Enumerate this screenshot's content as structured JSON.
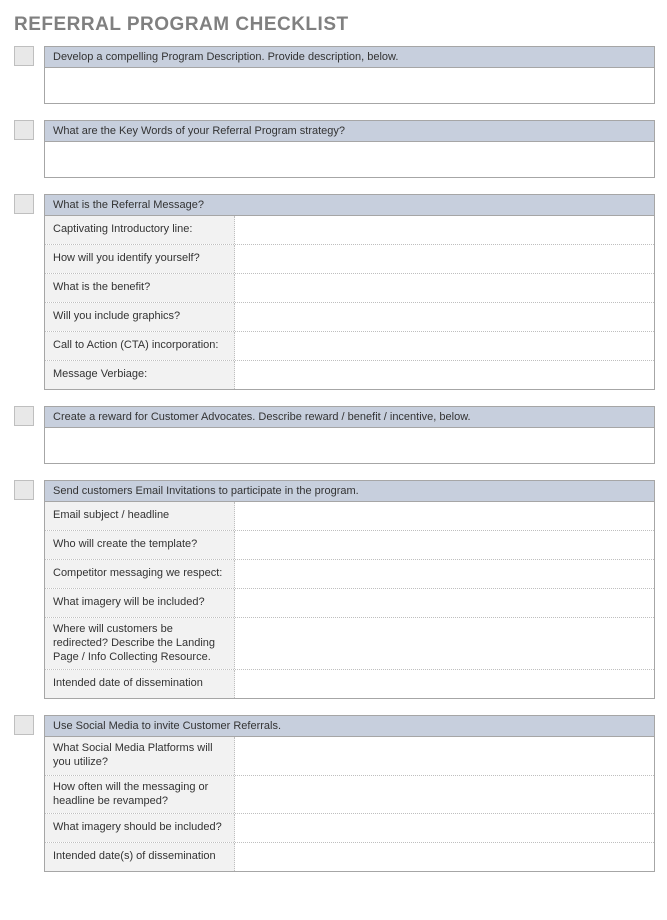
{
  "title": "REFERRAL PROGRAM CHECKLIST",
  "sections": [
    {
      "header": "Develop a compelling Program Description.  Provide description, below.",
      "textarea": true
    },
    {
      "header": "What are the Key Words of your Referral Program strategy?",
      "textarea": true
    },
    {
      "header": "What is the Referral Message?",
      "rows": [
        "Captivating Introductory line:",
        "How will you identify yourself?",
        "What is the benefit?",
        "Will you include graphics?",
        "Call to Action (CTA) incorporation:",
        "Message Verbiage:"
      ]
    },
    {
      "header": "Create a reward for Customer Advocates.  Describe reward / benefit / incentive, below.",
      "textarea": true
    },
    {
      "header": "Send customers Email Invitations to participate in the program.",
      "rows": [
        "Email subject / headline",
        "Who will create the template?",
        "Competitor messaging we respect:",
        "What imagery will be included?",
        "Where will customers be redirected? Describe the Landing Page / Info Collecting Resource.",
        "Intended date of dissemination"
      ]
    },
    {
      "header": "Use Social Media to invite Customer Referrals.",
      "rows": [
        "What Social Media Platforms will you utilize?",
        "How often will the messaging or headline be revamped?",
        "What imagery should be included?",
        "Intended date(s) of dissemination"
      ]
    }
  ]
}
